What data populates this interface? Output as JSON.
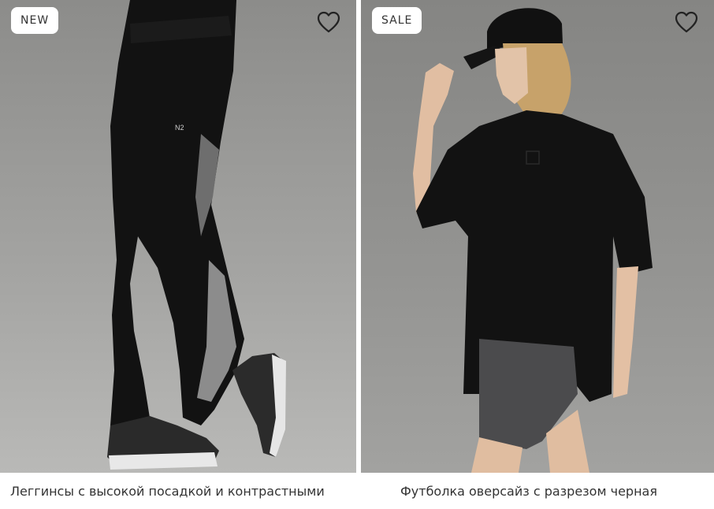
{
  "products": [
    {
      "badge": "NEW",
      "title": "Леггинсы с высокой посадкой и контрастными",
      "photo_icon": "leggings-photo",
      "wishlist_icon": "heart-outline-icon"
    },
    {
      "badge": "SALE",
      "title": "Футболка оверсайз с разрезом черная",
      "photo_icon": "tshirt-photo",
      "wishlist_icon": "heart-outline-icon"
    }
  ],
  "colors": {
    "background_left": "#9a9a98",
    "background_right": "#8f8f8d",
    "garment": "#111111",
    "badge_bg": "#ffffff",
    "text": "#333333"
  }
}
